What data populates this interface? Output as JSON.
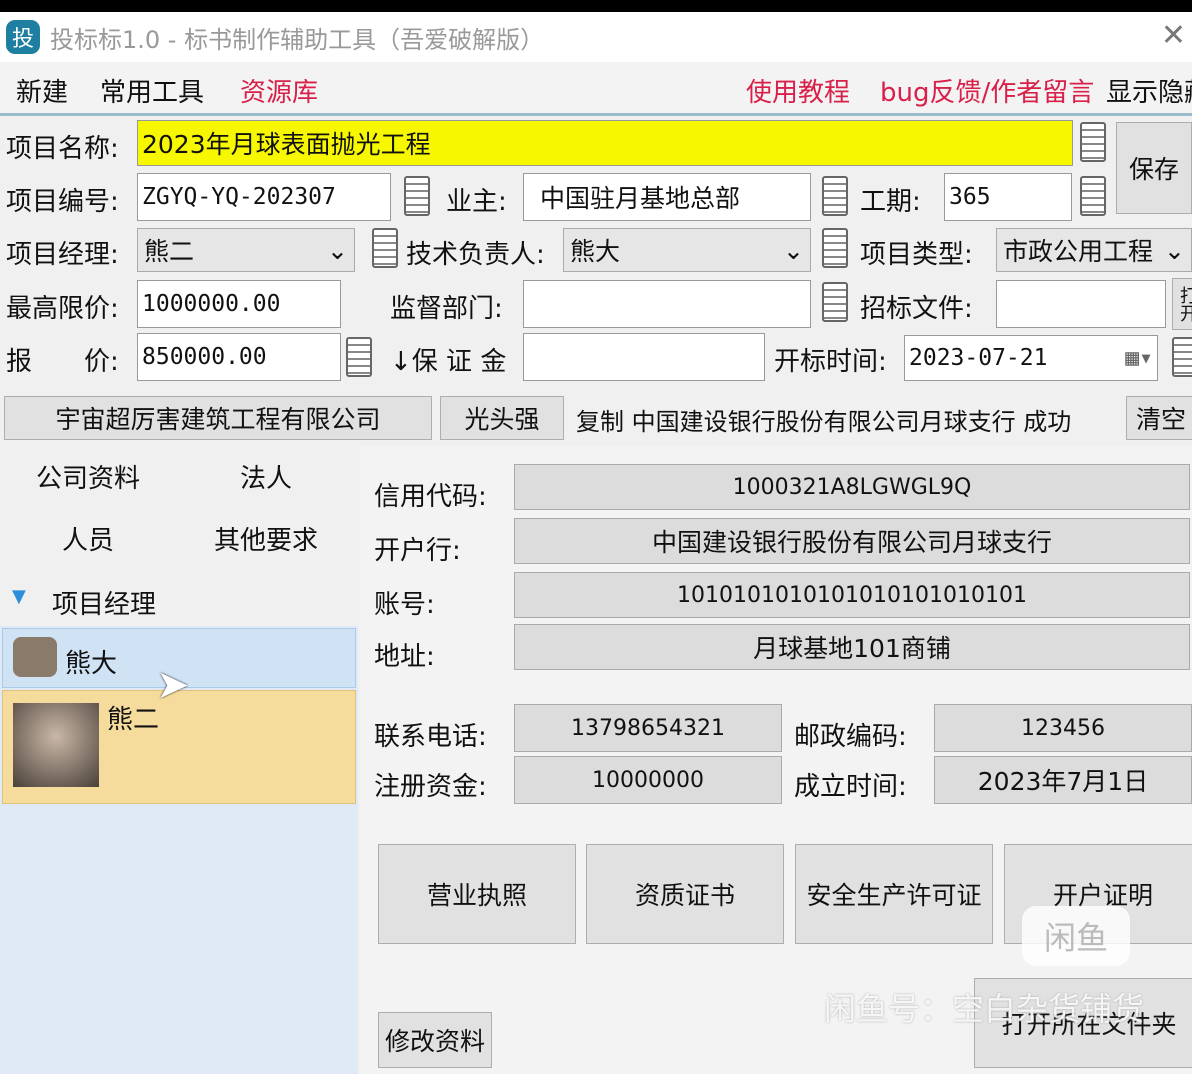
{
  "window": {
    "logo": "投",
    "title": "投标标1.0 - 标书制作辅助工具（吾爱破解版）",
    "close": "✕"
  },
  "menu": {
    "new": "新建",
    "tools": "常用工具",
    "resources": "资源库",
    "tutorial": "使用教程",
    "feedback": "bug反馈/作者留言",
    "toggle": "显示隐藏"
  },
  "form": {
    "name_label": "项目名称:",
    "name": "2023年月球表面抛光工程",
    "code_label": "项目编号:",
    "code": "ZGYQ-YQ-202307",
    "owner_label": "业主:",
    "owner": "中国驻月基地总部",
    "period_label": "工期:",
    "period": "365",
    "manager_label": "项目经理:",
    "manager": "熊二",
    "tech_label": "技术负责人:",
    "tech": "熊大",
    "type_label": "项目类型:",
    "type": "市政公用工程",
    "max_label": "最高限价:",
    "max": "1000000.00",
    "supervise_label": "监督部门:",
    "supervise": "",
    "tender_label": "招标文件:",
    "tender": "",
    "open_btn": "打开",
    "quote_label": "报　　价:",
    "quote": "850000.00",
    "deposit_label": "↓保 证 金",
    "deposit": "",
    "open_time_label": "开标时间:",
    "open_time": "2023-07-21",
    "save": "保存"
  },
  "bar": {
    "company": "宇宙超厉害建筑工程有限公司",
    "person": "光头强",
    "status": "复制 中国建设银行股份有限公司月球支行 成功",
    "clear": "清空"
  },
  "side": {
    "tabs": [
      "公司资料",
      "法人",
      "人员",
      "其他要求"
    ],
    "group": "项目经理",
    "people": [
      "熊大",
      "熊二"
    ]
  },
  "detail": {
    "credit_label": "信用代码:",
    "credit": "1000321A8LGWGL9Q",
    "bank_label": "开户行:",
    "bank": "中国建设银行股份有限公司月球支行",
    "account_label": "账号:",
    "account": "1010101010101010101010101",
    "address_label": "地址:",
    "address": "月球基地101商铺",
    "phone_label": "联系电话:",
    "phone": "13798654321",
    "zip_label": "邮政编码:",
    "zip": "123456",
    "capital_label": "注册资金:",
    "capital": "10000000",
    "founded_label": "成立时间:",
    "founded": "2023年7月1日",
    "buttons": [
      "营业执照",
      "资质证书",
      "安全生产许可证",
      "开户证明"
    ],
    "edit": "修改资料",
    "open_folder": "打开所在文件夹"
  },
  "watermark": {
    "logo": "闲鱼",
    "text": "闲鱼号：空白杂货铺货"
  }
}
